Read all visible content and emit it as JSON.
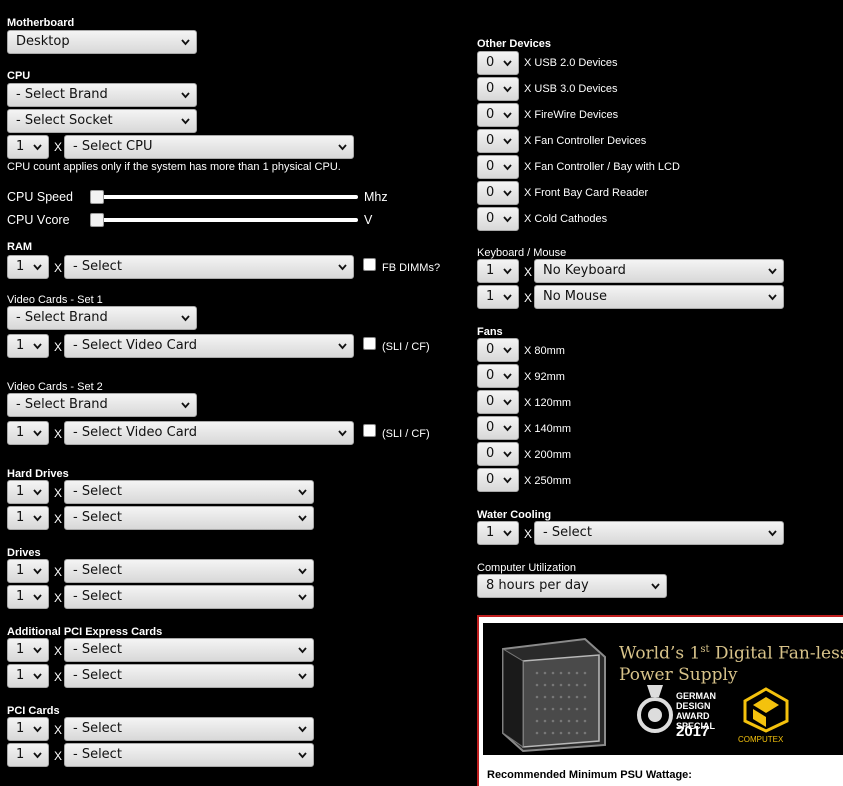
{
  "motherboard": {
    "label": "Motherboard",
    "value": "Desktop"
  },
  "cpu": {
    "label": "CPU",
    "brand": "- Select Brand",
    "socket": "- Select Socket",
    "count": "1",
    "x": "X",
    "cpu": "- Select CPU",
    "note": "CPU count applies only if the system has more than 1 physical CPU.",
    "speed_label": "CPU Speed",
    "speed_unit": "Mhz",
    "vcore_label": "CPU Vcore",
    "vcore_unit": "V"
  },
  "ram": {
    "label": "RAM",
    "count": "1",
    "x": "X",
    "value": "- Select",
    "fb_label": "FB DIMMs?"
  },
  "video1": {
    "label": "Video Cards - Set 1",
    "brand": "- Select Brand",
    "count": "1",
    "x": "X",
    "card": "- Select Video Card",
    "sli_label": "(SLI / CF)"
  },
  "video2": {
    "label": "Video Cards - Set 2",
    "brand": "- Select Brand",
    "count": "1",
    "x": "X",
    "card": "- Select Video Card",
    "sli_label": "(SLI / CF)"
  },
  "hard_drives": {
    "label": "Hard Drives",
    "rows": [
      {
        "count": "1",
        "x": "X",
        "value": "- Select"
      },
      {
        "count": "1",
        "x": "X",
        "value": "- Select"
      }
    ]
  },
  "drives": {
    "label": "Drives",
    "rows": [
      {
        "count": "1",
        "x": "X",
        "value": "- Select"
      },
      {
        "count": "1",
        "x": "X",
        "value": "- Select"
      }
    ]
  },
  "pcie": {
    "label": "Additional PCI Express Cards",
    "rows": [
      {
        "count": "1",
        "x": "X",
        "value": "- Select"
      },
      {
        "count": "1",
        "x": "X",
        "value": "- Select"
      }
    ]
  },
  "pci": {
    "label": "PCI Cards",
    "rows": [
      {
        "count": "1",
        "x": "X",
        "value": "- Select"
      },
      {
        "count": "1",
        "x": "X",
        "value": "- Select"
      }
    ]
  },
  "other_devices": {
    "label": "Other Devices",
    "rows": [
      {
        "count": "0",
        "label": "X USB 2.0 Devices"
      },
      {
        "count": "0",
        "label": "X USB 3.0 Devices"
      },
      {
        "count": "0",
        "label": "X FireWire Devices"
      },
      {
        "count": "0",
        "label": "X Fan Controller Devices"
      },
      {
        "count": "0",
        "label": "X Fan Controller / Bay with LCD"
      },
      {
        "count": "0",
        "label": "X Front Bay Card Reader"
      },
      {
        "count": "0",
        "label": "X Cold Cathodes"
      }
    ]
  },
  "keyboard_mouse": {
    "label": "Keyboard / Mouse",
    "rows": [
      {
        "count": "1",
        "x": "X",
        "value": "No Keyboard"
      },
      {
        "count": "1",
        "x": "X",
        "value": "No Mouse"
      }
    ]
  },
  "fans": {
    "label": "Fans",
    "rows": [
      {
        "count": "0",
        "label": "X 80mm"
      },
      {
        "count": "0",
        "label": "X 92mm"
      },
      {
        "count": "0",
        "label": "X 120mm"
      },
      {
        "count": "0",
        "label": "X 140mm"
      },
      {
        "count": "0",
        "label": "X 200mm"
      },
      {
        "count": "0",
        "label": "X 250mm"
      }
    ]
  },
  "water_cooling": {
    "label": "Water Cooling",
    "count": "1",
    "x": "X",
    "value": "- Select"
  },
  "utilization": {
    "label": "Computer Utilization",
    "value": "8 hours per day"
  },
  "ad": {
    "title_line1_a": "World’s 1",
    "title_sup": "st",
    "title_line1_b": " Digital Fan-less",
    "title_line2": "Power Supply",
    "award_l1": "GERMAN",
    "award_l2": "DESIGN",
    "award_l3": "AWARD",
    "award_l4": "SPECIAL",
    "award_year": "2017",
    "computex": "COMPUTEX"
  },
  "psu": {
    "label": "Recommended Minimum PSU Wattage:"
  },
  "colors": {
    "ad_border": "#c01f1f",
    "ad_gold": "#d8c38a",
    "computex_yellow": "#f4c20d"
  }
}
